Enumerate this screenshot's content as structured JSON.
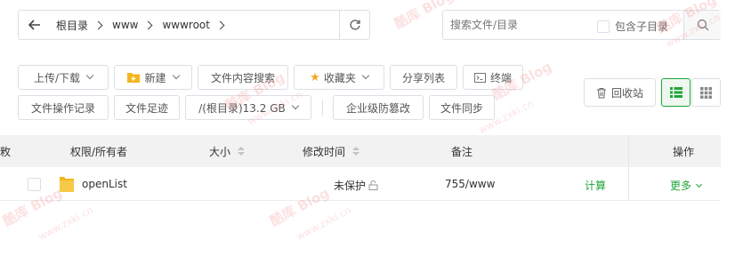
{
  "pathbar": {
    "back_icon": "arrow-left-icon",
    "crumbs": [
      "根目录",
      "www",
      "wwwroot"
    ],
    "refresh_icon": "refresh-icon"
  },
  "search": {
    "placeholder": "搜索文件/目录",
    "include_subdir_label": "包含子目录",
    "search_icon": "search-icon"
  },
  "toolbar": {
    "upload_download": "上传/下载",
    "new": "新建",
    "content_search": "文件内容搜索",
    "favorites": "收藏夹",
    "share_list": "分享列表",
    "terminal": "终端",
    "recycle_bin": "回收站",
    "file_op_log": "文件操作记录",
    "file_trace": "文件足迹",
    "disk": "/(根目录)13.2 GB",
    "tamper_proof": "企业级防篡改",
    "file_sync": "文件同步"
  },
  "table": {
    "headers": {
      "partial": "敉",
      "perm_owner": "权限/所有者",
      "size": "大小",
      "mtime": "修改时间",
      "note": "备注",
      "ops": "操作"
    },
    "rows": [
      {
        "name": "openList",
        "protection": "未保护",
        "note": "755/www",
        "calc": "计算",
        "more": "更多"
      }
    ]
  },
  "watermark": {
    "brand": "酷库 Blog",
    "url": "www.zxki.cn"
  },
  "colors": {
    "accent_green": "#20a53a",
    "folder_yellow": "#f3b61f",
    "star": "#f5a623"
  }
}
